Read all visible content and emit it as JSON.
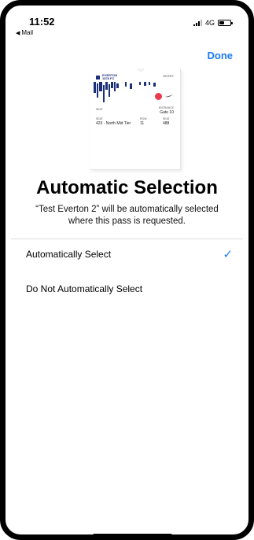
{
  "status_bar": {
    "time": "11:52",
    "back_app": "Mail",
    "network": "4G"
  },
  "nav": {
    "done_label": "Done"
  },
  "pass": {
    "brand": "EVERTON",
    "brand_sub": "1878 FC",
    "top_right": "ENTRY",
    "gate_label": "ENTRANCE",
    "gate_value": "Gate 10",
    "seat_label": "SEAT",
    "seat_value": "423 - North Mid Tier",
    "row_label": "ROW",
    "row_value": "11",
    "seat_no_label": "SEAT",
    "seat_no_value": "488"
  },
  "content": {
    "title": "Automatic Selection",
    "subtitle": "“Test Everton 2” will be automatically selected where this pass is requested."
  },
  "options": [
    {
      "label": "Automatically Select",
      "selected": true
    },
    {
      "label": "Do Not Automatically Select",
      "selected": false
    }
  ],
  "colors": {
    "accent": "#1a7df3",
    "pass_navy": "#1c2f7a",
    "pass_badge": "#e83a4b"
  }
}
